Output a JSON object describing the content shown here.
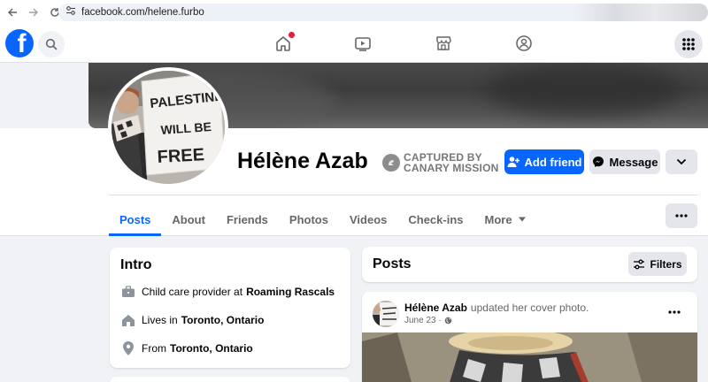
{
  "browser": {
    "url": "facebook.com/helene.furbo"
  },
  "profile": {
    "name": "Hélène Azab",
    "badge_line1": "CAPTURED BY",
    "badge_line2": "CANARY MISSION",
    "avatar_sign_lines": [
      "PALESTINE",
      "WILL BE",
      "FREE"
    ],
    "add_friend_label": "Add friend",
    "message_label": "Message"
  },
  "tabs": [
    {
      "label": "Posts",
      "active": true
    },
    {
      "label": "About",
      "active": false
    },
    {
      "label": "Friends",
      "active": false
    },
    {
      "label": "Photos",
      "active": false
    },
    {
      "label": "Videos",
      "active": false
    },
    {
      "label": "Check-ins",
      "active": false
    },
    {
      "label": "More",
      "active": false
    }
  ],
  "intro": {
    "title": "Intro",
    "work_prefix": "Child care provider at",
    "work_place": "Roaming Rascals",
    "lives_prefix": "Lives in",
    "lives_place": "Toronto, Ontario",
    "from_prefix": "From",
    "from_place": "Toronto, Ontario"
  },
  "posts": {
    "title": "Posts",
    "filters_label": "Filters",
    "items": [
      {
        "author": "Hélène Azab",
        "action": "updated her cover photo.",
        "date": "June 23 ·"
      }
    ]
  },
  "colors": {
    "brand": "#0866ff",
    "notification_dot": "#e41e3f"
  }
}
